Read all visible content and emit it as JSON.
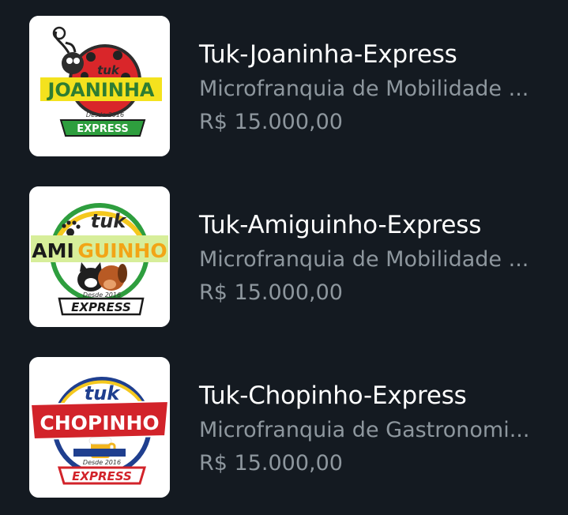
{
  "listings": [
    {
      "title": "Tuk-Joaninha-Express",
      "subtitle": "Microfranquia de Mobilidade ...",
      "price": "R$ 15.000,00",
      "logo": {
        "icon": "ladybug-logo-icon",
        "top_text": "tuk",
        "main_text": "JOANINHA",
        "since_text": "Desde 2016",
        "bottom_text": "EXPRESS"
      }
    },
    {
      "title": "Tuk-Amiguinho-Express",
      "subtitle": "Microfranquia de Mobilidade ...",
      "price": "R$ 15.000,00",
      "logo": {
        "icon": "pets-logo-icon",
        "top_text": "tuk",
        "main_text_a": "AMI",
        "main_text_b": "GUINHO",
        "since_text": "Desde 2016",
        "bottom_text": "EXPRESS"
      }
    },
    {
      "title": "Tuk-Chopinho-Express",
      "subtitle": "Microfranquia de Gastronomi...",
      "price": "R$ 15.000,00",
      "logo": {
        "icon": "beer-logo-icon",
        "top_text": "tuk",
        "main_text": "CHOPINHO",
        "since_text": "Desde 2016",
        "bottom_text": "EXPRESS"
      }
    }
  ],
  "colors": {
    "background": "#141a21",
    "title": "#ffffff",
    "secondary_text": "#8e979e"
  }
}
